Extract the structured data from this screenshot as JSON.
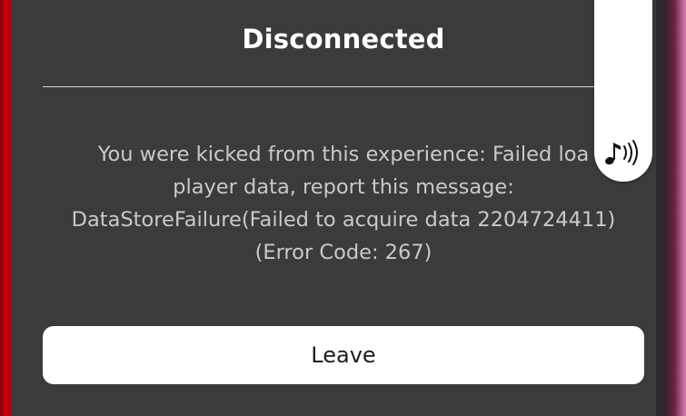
{
  "dialog": {
    "title": "Disconnected",
    "message_lines": [
      "You were kicked from this experience: Failed loa",
      "player data, report this message:",
      "DataStoreFailure(Failed to acquire data 2204724411)",
      "(Error Code: 267)"
    ],
    "leave_label": "Leave"
  },
  "overlay": {
    "voice_icon": "music-note-speaker-icon"
  },
  "colors": {
    "dialog_bg": "#393b3d",
    "title": "#ffffff",
    "message": "#c9c9c9",
    "button_bg": "#ffffff",
    "button_text": "#1d1d1f"
  }
}
